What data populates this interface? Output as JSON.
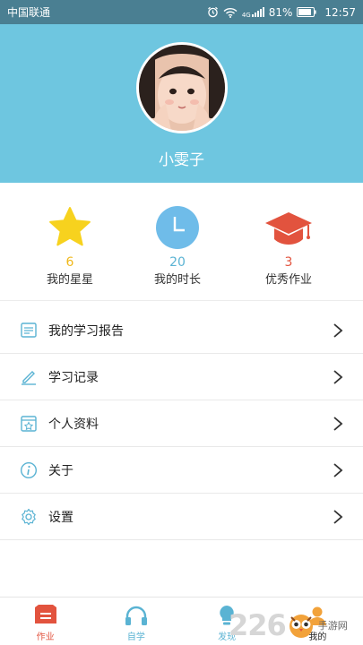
{
  "status_bar": {
    "carrier": "中国联通",
    "network": "4G",
    "battery": "81%",
    "time": "12:57"
  },
  "profile": {
    "username": "小雯子"
  },
  "stats": [
    {
      "value": "6",
      "label": "我的星星",
      "color": "#f7c52a"
    },
    {
      "value": "20",
      "label": "我的时长",
      "color": "#66b9e8"
    },
    {
      "value": "3",
      "label": "优秀作业",
      "color": "#e2533e"
    }
  ],
  "menu": [
    {
      "label": "我的学习报告",
      "icon": "report-icon"
    },
    {
      "label": "学习记录",
      "icon": "pencil-icon"
    },
    {
      "label": "个人资料",
      "icon": "profile-card-icon"
    },
    {
      "label": "关于",
      "icon": "info-icon"
    },
    {
      "label": "设置",
      "icon": "gear-icon"
    }
  ],
  "tabs": [
    {
      "label": "作业",
      "icon": "homework-icon",
      "color": "#e2533e"
    },
    {
      "label": "自学",
      "icon": "headphones-icon",
      "color": "#5ab3d3"
    },
    {
      "label": "发现",
      "icon": "bulb-icon",
      "color": "#5ab3d3"
    },
    {
      "label": "我的",
      "icon": "user-icon",
      "color": "#222222"
    }
  ],
  "watermark": {
    "number": "226",
    "site": "手游网"
  },
  "colors": {
    "header": "#6ec6e0",
    "status": "#4a7f92",
    "icon_blue": "#5ab3d3"
  }
}
